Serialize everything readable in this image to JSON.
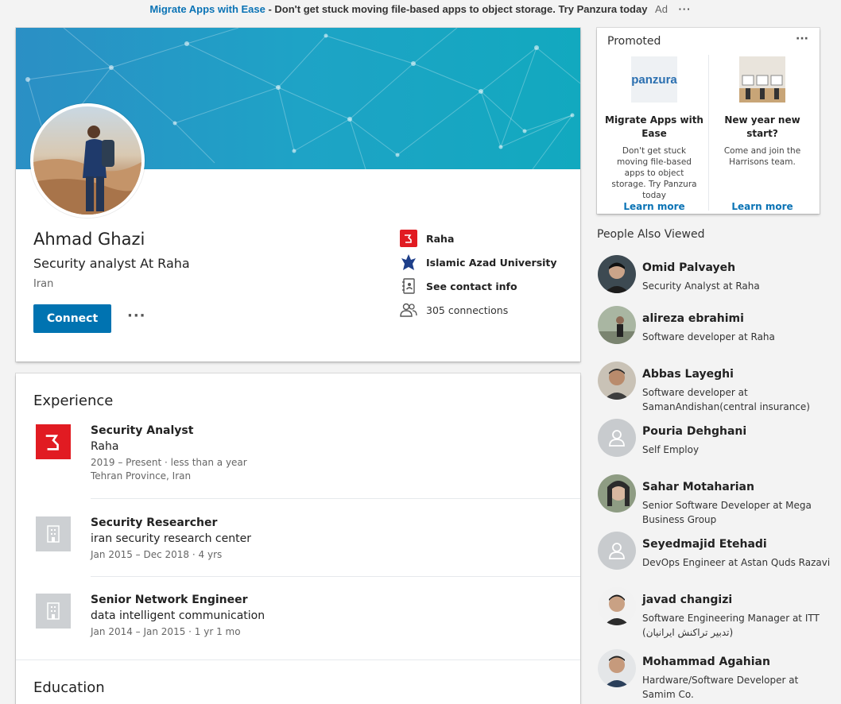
{
  "ad_bar": {
    "link_text": "Migrate Apps with Ease",
    "text": " - Don't get stuck moving file-based apps to object storage. Try Panzura today",
    "tag": "Ad",
    "more": "···"
  },
  "profile": {
    "name": "Ahmad Ghazi",
    "headline": "Security analyst At Raha",
    "location": "Iran",
    "connect_label": "Connect",
    "more_label": "···",
    "info": {
      "company": "Raha",
      "school": "Islamic Azad University",
      "contact": "See contact info",
      "connections": "305 connections"
    }
  },
  "experience": {
    "title": "Experience",
    "items": [
      {
        "title": "Security Analyst",
        "company": "Raha",
        "dates": "2019 – Present",
        "duration": "less than a year",
        "location": "Tehran Province, Iran"
      },
      {
        "title": "Security Researcher",
        "company": "iran security research center",
        "dates": "Jan 2015 – Dec 2018",
        "duration": "4 yrs"
      },
      {
        "title": "Senior Network Engineer",
        "company": "data intelligent communication",
        "dates": "Jan 2014 – Jan 2015",
        "duration": "1 yr 1 mo"
      }
    ]
  },
  "education": {
    "title": "Education"
  },
  "promoted": {
    "title": "Promoted",
    "more": "···",
    "ads": [
      {
        "logo_text": "panzura",
        "title": "Migrate Apps with Ease",
        "desc": "Don't get stuck moving file-based apps to object storage. Try Panzura today",
        "link": "Learn more"
      },
      {
        "title": "New year new start?",
        "desc": "Come and join the Harrisons team.",
        "link": "Learn more"
      }
    ]
  },
  "people_also_viewed": {
    "title": "People Also Viewed",
    "people": [
      {
        "name": "Omid Palvayeh",
        "headline": "Security Analyst at Raha"
      },
      {
        "name": "alireza ebrahimi",
        "headline": "Software developer at Raha"
      },
      {
        "name": "Abbas Layeghi",
        "headline": "Software developer at SamanAndishan(central insurance)"
      },
      {
        "name": "Pouria Dehghani",
        "headline": "Self Employ"
      },
      {
        "name": "Sahar Motaharian",
        "headline": "Senior Software Developer at Mega Business Group"
      },
      {
        "name": "Seyedmajid Etehadi",
        "headline": "DevOps Engineer at Astan Quds Razavi"
      },
      {
        "name": "javad changizi",
        "headline": "Software Engineering Manager at ITT (تدبیر تراکنش ایرانیان)"
      },
      {
        "name": "Mohammad Agahian",
        "headline": "Hardware/Software Developer at Samim Co."
      }
    ]
  }
}
